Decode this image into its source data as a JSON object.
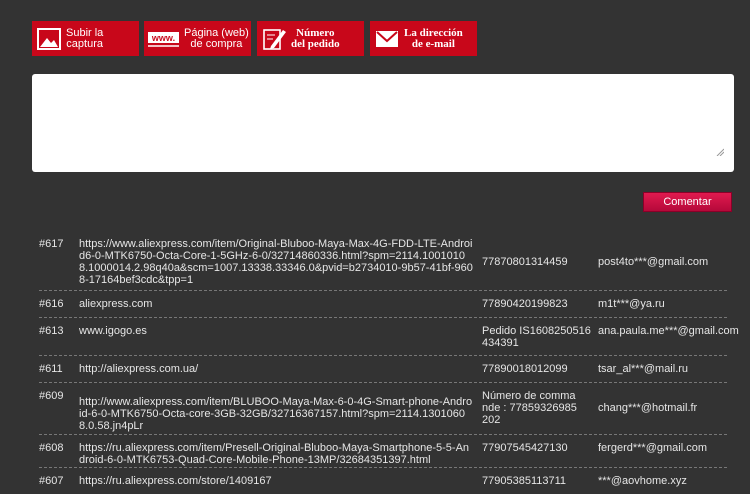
{
  "toolbar": {
    "upload": "Subir la\ncaptura",
    "webpage": "Página (web)\nde compra",
    "order_number": "Número\ndel pedido",
    "email": "La dirección\nde e-mail",
    "www_badge": "www."
  },
  "comment": {
    "placeholder": ""
  },
  "submit_label": "Comentar",
  "entries": [
    {
      "num": "#617",
      "url": "https://www.aliexpress.com/item/Original-Bluboo-Maya-Max-4G-FDD-LTE-Android6-0-MTK6750-Octa-Core-1-5GHz-6-0/32714860336.html?spm=2114.10010108.1000014.2.98q40a&scm=1007.13338.33346.0&pvid=b2734010-9b57-41bf-9608-17164bef3cdc&tpp=1",
      "order": "77870801314459",
      "email": "post4to***@gmail.com"
    },
    {
      "num": "#616",
      "url": "aliexpress.com",
      "order": "77890420199823",
      "email": "m1t***@ya.ru"
    },
    {
      "num": "#613",
      "url": "www.igogo.es",
      "order": "Pedido IS1608250516434391",
      "email": "ana.paula.me***@gmail.com"
    },
    {
      "num": "#611",
      "url": "http://aliexpress.com.ua/",
      "order": "77890018012099",
      "email": "tsar_al***@mail.ru"
    },
    {
      "num": "#609",
      "url": "http://www.aliexpress.com/item/BLUBOO-Maya-Max-6-0-4G-Smart-phone-Android-6-0-MTK6750-Octa-core-3GB-32GB/32716367157.html?spm=2114.13010608.0.58.jn4pLr",
      "order": "Número de commande : 77859326985202",
      "email": "chang***@hotmail.fr"
    },
    {
      "num": "#608",
      "url": "https://ru.aliexpress.com/item/Presell-Original-Bluboo-Maya-Smartphone-5-5-Android-6-0-MTK6753-Quad-Core-Mobile-Phone-13MP/32684351397.html",
      "order": "77907545427130",
      "email": "fergerd***@gmail.com"
    },
    {
      "num": "#607",
      "url": "https://ru.aliexpress.com/store/1409167",
      "order": "77905385113711",
      "email": "***@aovhome.xyz"
    }
  ]
}
